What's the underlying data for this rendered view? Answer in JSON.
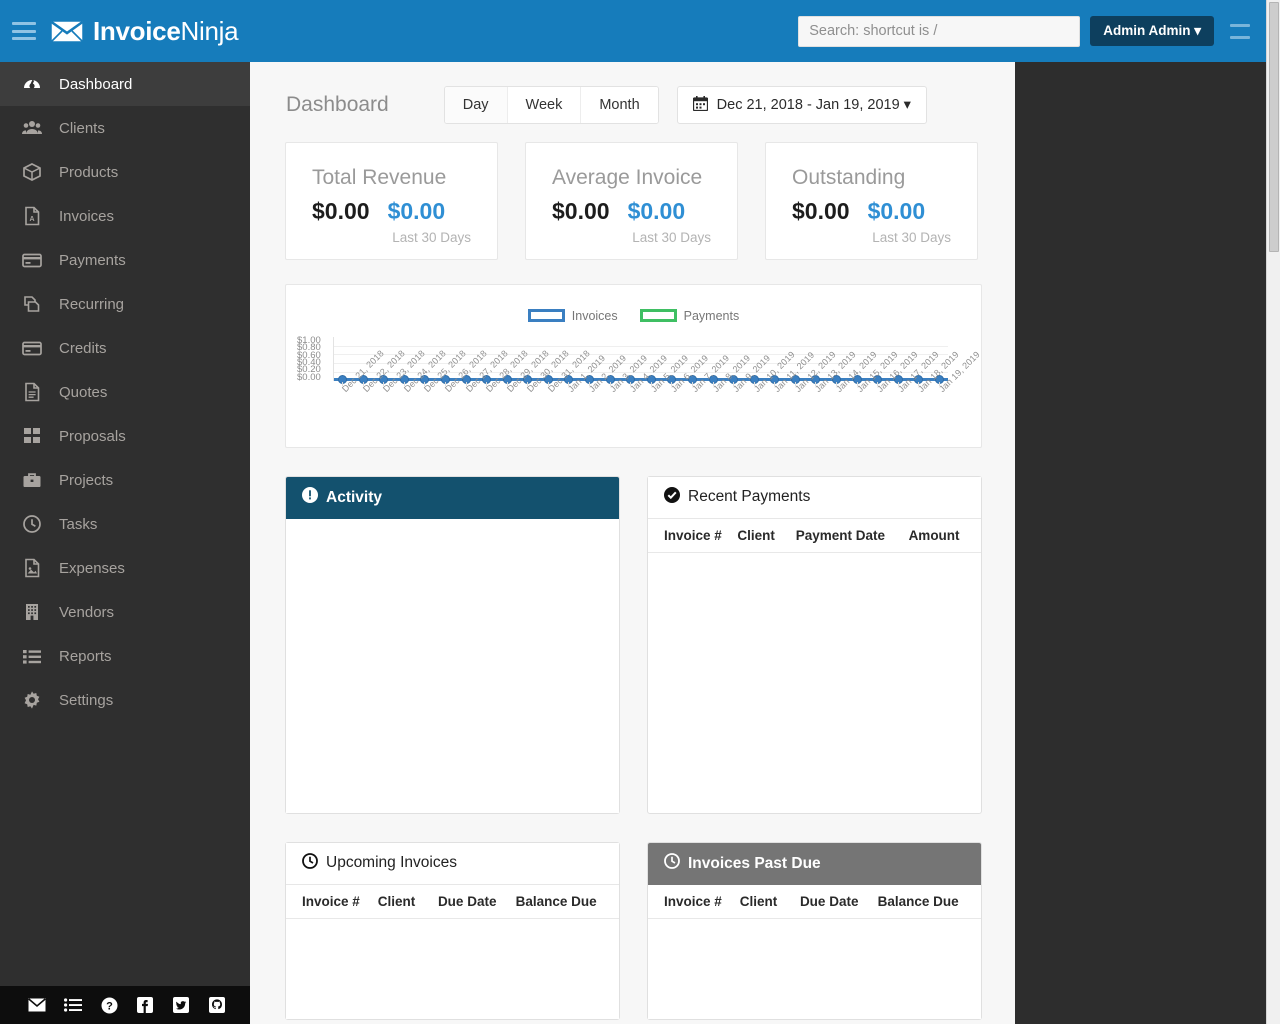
{
  "header": {
    "brand_bold": "Invoice",
    "brand_light": "Ninja",
    "search_placeholder": "Search: shortcut is /",
    "user_label": "Admin Admin ▾",
    "menu_icon": "hamburger-icon",
    "mail_icon": "envelope-logo-icon",
    "accent_color": "#167cbb"
  },
  "sidebar": {
    "items": [
      {
        "label": "Dashboard",
        "icon": "dashboard-icon",
        "active": true
      },
      {
        "label": "Clients",
        "icon": "users-icon",
        "active": false
      },
      {
        "label": "Products",
        "icon": "box-icon",
        "active": false
      },
      {
        "label": "Invoices",
        "icon": "file-pdf-icon",
        "active": false
      },
      {
        "label": "Payments",
        "icon": "credit-card-icon",
        "active": false
      },
      {
        "label": "Recurring",
        "icon": "copy-files-icon",
        "active": false
      },
      {
        "label": "Credits",
        "icon": "credit-card-icon",
        "active": false
      },
      {
        "label": "Quotes",
        "icon": "file-text-icon",
        "active": false
      },
      {
        "label": "Proposals",
        "icon": "grid-squares-icon",
        "active": false
      },
      {
        "label": "Projects",
        "icon": "briefcase-icon",
        "active": false
      },
      {
        "label": "Tasks",
        "icon": "clock-icon",
        "active": false
      },
      {
        "label": "Expenses",
        "icon": "file-image-icon",
        "active": false
      },
      {
        "label": "Vendors",
        "icon": "building-icon",
        "active": false
      },
      {
        "label": "Reports",
        "icon": "list-icon",
        "active": false
      },
      {
        "label": "Settings",
        "icon": "gear-icon",
        "active": false
      }
    ],
    "footer_icons": [
      "envelope-icon",
      "list-icon",
      "question-circle-icon",
      "facebook-icon",
      "twitter-icon",
      "github-icon"
    ]
  },
  "main": {
    "page_title": "Dashboard",
    "range_buttons": [
      {
        "label": "Day",
        "active": true
      },
      {
        "label": "Week",
        "active": false
      },
      {
        "label": "Month",
        "active": false
      }
    ],
    "date_range": "Dec 21, 2018 - Jan 19, 2019 ▾",
    "calendar_icon": "calendar-icon"
  },
  "cards": [
    {
      "title": "Total Revenue",
      "value_dark": "$0.00",
      "value_blue": "$0.00",
      "subtitle": "Last 30 Days"
    },
    {
      "title": "Average Invoice",
      "value_dark": "$0.00",
      "value_blue": "$0.00",
      "subtitle": "Last 30 Days"
    },
    {
      "title": "Outstanding",
      "value_dark": "$0.00",
      "value_blue": "$0.00",
      "subtitle": "Last 30 Days"
    }
  ],
  "chart_data": {
    "type": "line",
    "title": "",
    "xlabel": "",
    "ylabel": "",
    "ylim": [
      0,
      1
    ],
    "grid": true,
    "legend_position": "top-center",
    "ytick_labels": [
      "$1.00",
      "$0.80",
      "$0.60",
      "$0.40",
      "$0.20",
      "$0.00"
    ],
    "ytick_values": [
      1.0,
      0.8,
      0.6,
      0.4,
      0.2,
      0.0
    ],
    "x": [
      "Dec 21, 2018",
      "Dec 22, 2018",
      "Dec 23, 2018",
      "Dec 24, 2018",
      "Dec 25, 2018",
      "Dec 26, 2018",
      "Dec 27, 2018",
      "Dec 28, 2018",
      "Dec 29, 2018",
      "Dec 30, 2018",
      "Dec 31, 2018",
      "Jan 1, 2019",
      "Jan 2, 2019",
      "Jan 3, 2019",
      "Jan 4, 2019",
      "Jan 5, 2019",
      "Jan 6, 2019",
      "Jan 7, 2019",
      "Jan 8, 2019",
      "Jan 9, 2019",
      "Jan 10, 2019",
      "Jan 11, 2019",
      "Jan 12, 2019",
      "Jan 13, 2019",
      "Jan 14, 2019",
      "Jan 15, 2019",
      "Jan 16, 2019",
      "Jan 17, 2019",
      "Jan 18, 2019",
      "Jan 19, 2019"
    ],
    "series": [
      {
        "name": "Invoices",
        "color": "#3a7fc1",
        "values": [
          0,
          0,
          0,
          0,
          0,
          0,
          0,
          0,
          0,
          0,
          0,
          0,
          0,
          0,
          0,
          0,
          0,
          0,
          0,
          0,
          0,
          0,
          0,
          0,
          0,
          0,
          0,
          0,
          0,
          0
        ]
      },
      {
        "name": "Payments",
        "color": "#3fbf63",
        "values": [
          0,
          0,
          0,
          0,
          0,
          0,
          0,
          0,
          0,
          0,
          0,
          0,
          0,
          0,
          0,
          0,
          0,
          0,
          0,
          0,
          0,
          0,
          0,
          0,
          0,
          0,
          0,
          0,
          0,
          0
        ]
      }
    ]
  },
  "panels": {
    "activity": {
      "title": "Activity",
      "icon": "exclamation-circle-icon",
      "style": "navy"
    },
    "recent_payments": {
      "title": "Recent Payments",
      "icon": "check-circle-icon",
      "style": "plain",
      "columns": [
        "Invoice #",
        "Client",
        "Payment Date",
        "Amount"
      ],
      "rows": []
    },
    "upcoming_invoices": {
      "title": "Upcoming Invoices",
      "icon": "clock-icon",
      "style": "plain",
      "columns": [
        "Invoice #",
        "Client",
        "Due Date",
        "Balance Due"
      ],
      "rows": []
    },
    "past_due": {
      "title": "Invoices Past Due",
      "icon": "clock-icon",
      "style": "gray",
      "columns": [
        "Invoice #",
        "Client",
        "Due Date",
        "Balance Due"
      ],
      "rows": []
    }
  }
}
